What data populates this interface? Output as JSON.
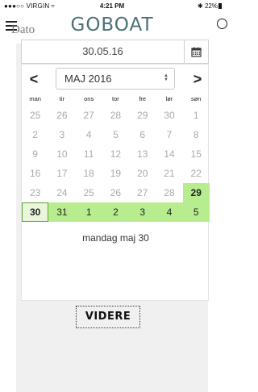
{
  "status_bar": {
    "carrier": "●●●○○ VIRGIN",
    "time": "4:21 PM",
    "battery": "22%"
  },
  "header": {
    "brand": "GOBOAT",
    "menu_icon": "hamburger-icon",
    "search_icon": "search-icon"
  },
  "form": {
    "date_label": "Dato",
    "date_value": "30.05.16",
    "calendar_icon": "calendar-icon",
    "next_button": "VIDERE"
  },
  "datepicker": {
    "prev": "<",
    "next": ">",
    "month_label": "MAJ 2016",
    "weekdays": [
      "man",
      "tir",
      "ons",
      "tor",
      "fre",
      "lør",
      "søn"
    ],
    "weeks": [
      [
        "25",
        "26",
        "27",
        "28",
        "29",
        "30",
        "1"
      ],
      [
        "2",
        "3",
        "4",
        "5",
        "6",
        "7",
        "8"
      ],
      [
        "9",
        "10",
        "11",
        "12",
        "13",
        "14",
        "15"
      ],
      [
        "16",
        "17",
        "18",
        "19",
        "20",
        "21",
        "22"
      ],
      [
        "23",
        "24",
        "25",
        "26",
        "27",
        "28",
        "29"
      ],
      [
        "30",
        "31",
        "1",
        "2",
        "3",
        "4",
        "5"
      ]
    ],
    "selected_label": "mandag maj 30"
  },
  "colors": {
    "brand": "#4a6f77",
    "highlight": "#b7ed8f",
    "selected_border": "#5fa23a"
  }
}
